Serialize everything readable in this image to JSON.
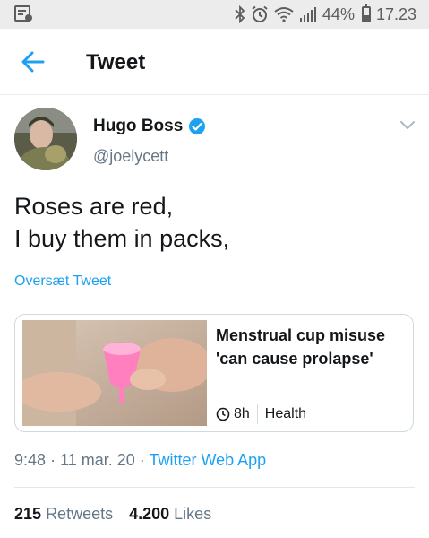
{
  "status_bar": {
    "battery_percent": "44%",
    "time": "17.23",
    "icons": [
      "bluetooth-icon",
      "alarm-icon",
      "wifi-icon",
      "signal-icon",
      "battery-icon"
    ]
  },
  "header": {
    "title": "Tweet",
    "back_icon": "back-arrow-icon"
  },
  "tweet": {
    "author_name": "Hugo Boss",
    "author_handle": "@joelycett",
    "text_line1": "Roses are red,",
    "text_line2": "I buy them in packs,",
    "translate_label": "Oversæt Tweet",
    "card": {
      "title": "Menstrual cup misuse 'can cause prolapse'",
      "age": "8h",
      "section": "Health"
    },
    "time": "9:48",
    "date": "11 mar. 20",
    "source": "Twitter Web App",
    "retweets_count": "215",
    "retweets_label": "Retweets",
    "likes_count": "4.200",
    "likes_label": "Likes"
  },
  "colors": {
    "accent": "#1da1f2",
    "text": "#14171a",
    "secondary": "#657786",
    "status_bar": "#ececec"
  }
}
